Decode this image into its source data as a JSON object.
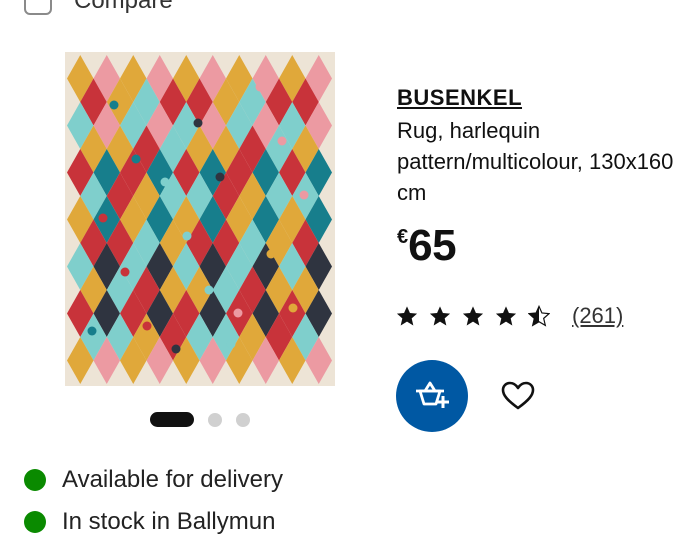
{
  "compare": {
    "label": "Compare"
  },
  "product": {
    "name": "BUSENKEL",
    "description": "Rug, harlequin pattern/multicolour, 130x160 cm",
    "currency": "€",
    "price": "65",
    "rating": 4.5,
    "review_count": "(261)"
  },
  "carousel": {
    "total": 3,
    "active": 1
  },
  "availability": [
    {
      "text": "Available for delivery",
      "status_color": "#0a8a00"
    },
    {
      "text": "In stock in Ballymun",
      "status_color": "#0a8a00"
    }
  ],
  "icons": {
    "cart": "add-to-cart-icon",
    "favourite": "heart-icon",
    "star": "star-icon"
  },
  "colors": {
    "accent": "#0058a3",
    "in_stock": "#0a8a00",
    "rug_background": "#ede4d6"
  }
}
